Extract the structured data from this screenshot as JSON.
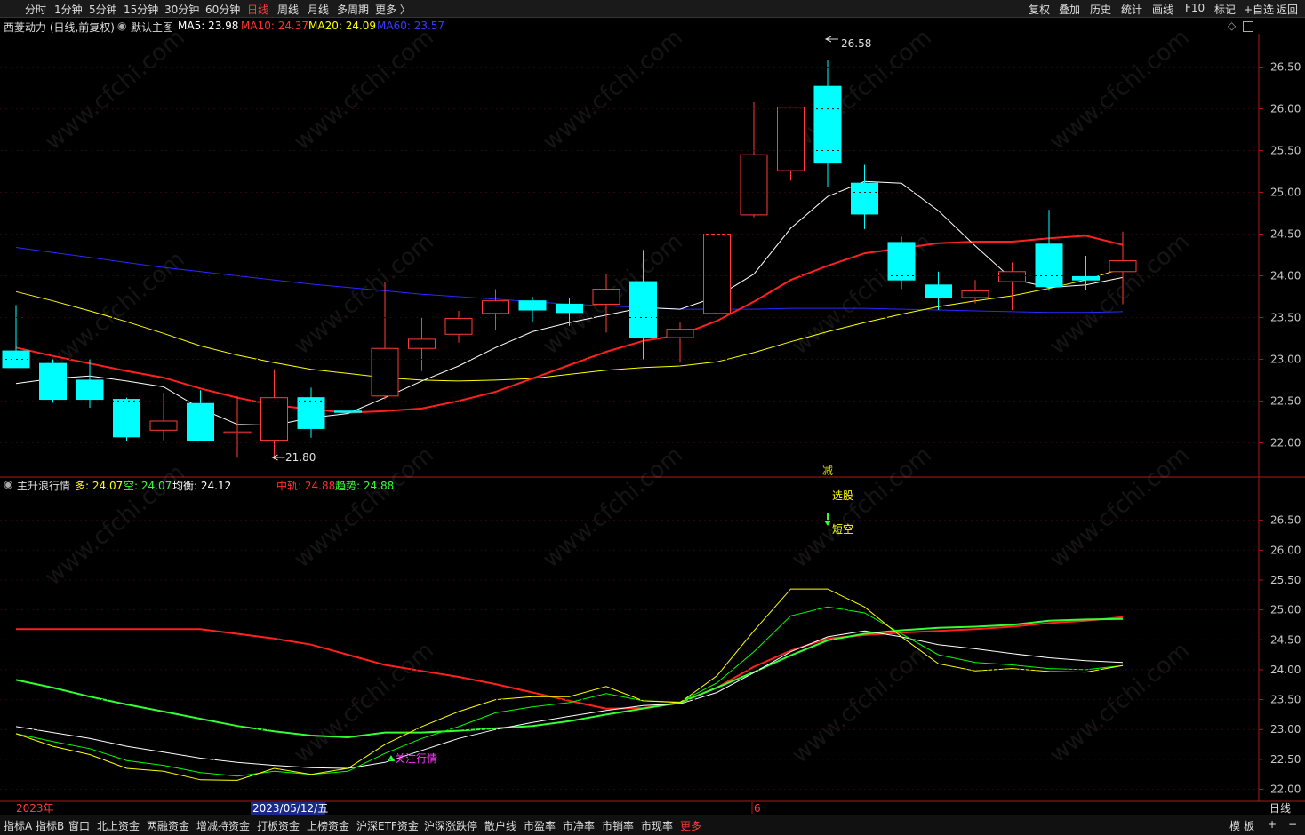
{
  "top_tabs": [
    "分时",
    "1分钟",
    "5分钟",
    "15分钟",
    "30分钟",
    "60分钟",
    "日线",
    "周线",
    "月线",
    "多周期",
    "更多 〉"
  ],
  "active_tab": "日线",
  "top_right": [
    "复权",
    "叠加",
    "历史",
    "统计",
    "画线",
    "F10",
    "标记",
    "+自选",
    "返回"
  ],
  "main_header": {
    "stock": "西菱动力 (日线,前复权)",
    "template": "默认主图",
    "ma5": "MA5: 23.98",
    "ma10": "MA10: 24.37",
    "ma20": "MA20: 24.09",
    "ma60": "MA60: 23.57"
  },
  "sub_header": {
    "name": "主升浪行情",
    "duo": "多: 24.07",
    "kong": "空: 24.07",
    "junheng": "均衡: 24.12",
    "zhonggui": "中轨: 24.88",
    "qushi": "趋势: 24.88"
  },
  "annotations": {
    "high": "26.58",
    "low": "21.80",
    "jian": "减",
    "xuanze": "选股",
    "duankong": "短空",
    "guanzhu": "关注行情"
  },
  "bottom_row": {
    "year": "2023年",
    "date": "2023/05/12/五",
    "month": "6",
    "period": "日线"
  },
  "bottom_tabs": [
    "指标A",
    "指标B",
    "窗口",
    "北上资金",
    "两融资金",
    "增减持资金",
    "打板资金",
    "上榜资金",
    "沪深ETF资金",
    "沪深涨跌停",
    "散户线",
    "市盈率",
    "市净率",
    "市销率",
    "市现率",
    "更多"
  ],
  "bottom_right": [
    "模",
    "板",
    "+",
    "−"
  ],
  "colors": {
    "up": "#ff3b3b",
    "down": "#00ffff",
    "ma5": "#ffffff",
    "ma10": "#ff2020",
    "ma20": "#ffff00",
    "ma60": "#2a2aff",
    "duo": "#ffff00",
    "kong": "#00ff00",
    "junheng": "#ffffff",
    "zhonggui": "#ff2020",
    "qushi": "#33ff33"
  },
  "chart_data": {
    "type": "candlestick",
    "y_ticks_main": [
      "26.50",
      "26.00",
      "25.50",
      "25.00",
      "24.50",
      "24.00",
      "23.50",
      "23.00",
      "22.50",
      "22.00"
    ],
    "y_ticks_sub": [
      "26.50",
      "26.00",
      "25.50",
      "25.00",
      "24.50",
      "24.00",
      "23.50",
      "23.00",
      "22.50",
      "22.00"
    ],
    "ylim_main": [
      21.6,
      26.9
    ],
    "ylim_sub": [
      21.8,
      27.0
    ],
    "candles": [
      {
        "o": 23.1,
        "h": 23.65,
        "l": 22.9,
        "c": 22.9
      },
      {
        "o": 22.95,
        "h": 23.0,
        "l": 22.48,
        "c": 22.52
      },
      {
        "o": 22.75,
        "h": 23.0,
        "l": 22.42,
        "c": 22.52
      },
      {
        "o": 22.52,
        "h": 22.54,
        "l": 22.02,
        "c": 22.07
      },
      {
        "o": 22.15,
        "h": 22.6,
        "l": 22.03,
        "c": 22.26
      },
      {
        "o": 22.47,
        "h": 22.63,
        "l": 22.02,
        "c": 22.03
      },
      {
        "o": 22.13,
        "h": 22.56,
        "l": 21.82,
        "c": 22.13
      },
      {
        "o": 22.03,
        "h": 22.88,
        "l": 21.8,
        "c": 22.54
      },
      {
        "o": 22.54,
        "h": 22.66,
        "l": 22.06,
        "c": 22.17
      },
      {
        "o": 22.38,
        "h": 22.42,
        "l": 22.12,
        "c": 22.37
      },
      {
        "o": 22.56,
        "h": 23.93,
        "l": 22.52,
        "c": 23.13
      },
      {
        "o": 23.13,
        "h": 23.5,
        "l": 22.86,
        "c": 23.24
      },
      {
        "o": 23.3,
        "h": 23.58,
        "l": 23.2,
        "c": 23.49
      },
      {
        "o": 23.55,
        "h": 23.84,
        "l": 23.35,
        "c": 23.7
      },
      {
        "o": 23.7,
        "h": 23.75,
        "l": 23.44,
        "c": 23.59
      },
      {
        "o": 23.66,
        "h": 23.73,
        "l": 23.4,
        "c": 23.56
      },
      {
        "o": 23.66,
        "h": 24.02,
        "l": 23.32,
        "c": 23.84
      },
      {
        "o": 23.93,
        "h": 24.31,
        "l": 23.0,
        "c": 23.26
      },
      {
        "o": 23.26,
        "h": 23.44,
        "l": 22.96,
        "c": 23.36
      },
      {
        "o": 23.55,
        "h": 25.45,
        "l": 23.5,
        "c": 24.5
      },
      {
        "o": 24.73,
        "h": 26.08,
        "l": 24.7,
        "c": 25.45
      },
      {
        "o": 25.26,
        "h": 26.03,
        "l": 25.14,
        "c": 26.02
      },
      {
        "o": 26.27,
        "h": 26.58,
        "l": 25.07,
        "c": 25.35
      },
      {
        "o": 25.11,
        "h": 25.33,
        "l": 24.56,
        "c": 24.74
      },
      {
        "o": 24.4,
        "h": 24.47,
        "l": 23.84,
        "c": 23.95
      },
      {
        "o": 23.89,
        "h": 24.05,
        "l": 23.59,
        "c": 23.74
      },
      {
        "o": 23.74,
        "h": 23.95,
        "l": 23.67,
        "c": 23.82
      },
      {
        "o": 23.93,
        "h": 24.16,
        "l": 23.59,
        "c": 24.05
      },
      {
        "o": 24.38,
        "h": 24.79,
        "l": 23.82,
        "c": 23.87
      },
      {
        "o": 23.99,
        "h": 24.24,
        "l": 23.83,
        "c": 23.95
      },
      {
        "o": 24.05,
        "h": 24.53,
        "l": 23.66,
        "c": 24.18
      }
    ],
    "ma5": [
      22.71,
      22.77,
      22.8,
      22.74,
      22.67,
      22.41,
      22.22,
      22.21,
      22.3,
      22.35,
      22.54,
      22.74,
      22.92,
      23.14,
      23.33,
      23.44,
      23.53,
      23.62,
      23.6,
      23.75,
      24.02,
      24.57,
      24.95,
      25.13,
      25.11,
      24.78,
      24.36,
      23.96,
      23.86,
      23.89,
      23.98
    ],
    "ma10": [
      23.14,
      23.04,
      22.95,
      22.86,
      22.78,
      22.65,
      22.54,
      22.45,
      22.4,
      22.36,
      22.38,
      22.41,
      22.5,
      22.61,
      22.77,
      22.93,
      23.09,
      23.22,
      23.29,
      23.46,
      23.69,
      23.95,
      24.12,
      24.27,
      24.33,
      24.39,
      24.41,
      24.41,
      24.45,
      24.48,
      24.37
    ],
    "ma20": [
      23.81,
      23.7,
      23.58,
      23.45,
      23.31,
      23.16,
      23.05,
      22.96,
      22.88,
      22.83,
      22.78,
      22.75,
      22.74,
      22.75,
      22.77,
      22.82,
      22.87,
      22.9,
      22.92,
      22.97,
      23.08,
      23.21,
      23.33,
      23.44,
      23.54,
      23.63,
      23.7,
      23.76,
      23.85,
      23.95,
      24.09
    ],
    "ma60": [
      24.34,
      24.28,
      24.22,
      24.16,
      24.1,
      24.05,
      24.0,
      23.95,
      23.9,
      23.86,
      23.82,
      23.78,
      23.75,
      23.72,
      23.69,
      23.66,
      23.64,
      23.62,
      23.6,
      23.6,
      23.6,
      23.61,
      23.61,
      23.61,
      23.6,
      23.59,
      23.58,
      23.57,
      23.56,
      23.56,
      23.57
    ],
    "duo": [
      22.93,
      22.72,
      22.58,
      22.35,
      22.3,
      22.16,
      22.15,
      22.35,
      22.25,
      22.35,
      22.75,
      23.05,
      23.3,
      23.5,
      23.55,
      23.55,
      23.72,
      23.48,
      23.45,
      23.9,
      24.65,
      25.35,
      25.35,
      25.05,
      24.55,
      24.1,
      23.98,
      24.02,
      23.97,
      23.96,
      24.07
    ],
    "kong": [
      22.93,
      22.8,
      22.68,
      22.48,
      22.4,
      22.28,
      22.22,
      22.3,
      22.25,
      22.3,
      22.6,
      22.85,
      23.05,
      23.28,
      23.38,
      23.45,
      23.6,
      23.48,
      23.46,
      23.78,
      24.3,
      24.9,
      25.05,
      24.95,
      24.6,
      24.25,
      24.12,
      24.08,
      24.02,
      24.0,
      24.07
    ],
    "junheng": [
      23.05,
      22.95,
      22.85,
      22.72,
      22.62,
      22.52,
      22.45,
      22.4,
      22.36,
      22.35,
      22.45,
      22.65,
      22.85,
      23.0,
      23.12,
      23.22,
      23.32,
      23.4,
      23.43,
      23.62,
      23.95,
      24.3,
      24.55,
      24.65,
      24.55,
      24.42,
      24.35,
      24.27,
      24.2,
      24.15,
      24.12
    ],
    "zhonggui": [
      24.68,
      24.68,
      24.68,
      24.68,
      24.68,
      24.68,
      24.6,
      24.52,
      24.42,
      24.25,
      24.08,
      23.98,
      23.88,
      23.76,
      23.62,
      23.48,
      23.35,
      23.36,
      23.45,
      23.7,
      24.05,
      24.32,
      24.52,
      24.58,
      24.62,
      24.65,
      24.68,
      24.72,
      24.78,
      24.82,
      24.88
    ],
    "qushi": [
      23.83,
      23.7,
      23.55,
      23.42,
      23.3,
      23.18,
      23.06,
      22.97,
      22.9,
      22.87,
      22.95,
      22.95,
      22.98,
      23.02,
      23.06,
      23.14,
      23.25,
      23.35,
      23.45,
      23.7,
      23.96,
      24.24,
      24.49,
      24.6,
      24.66,
      24.7,
      24.72,
      24.75,
      24.82,
      24.84,
      24.85
    ]
  }
}
